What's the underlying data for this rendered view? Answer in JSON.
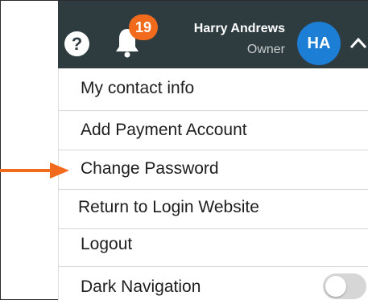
{
  "header": {
    "notification_count": "19",
    "user_name": "Harry Andrews",
    "user_role": "Owner",
    "avatar_initials": "HA",
    "help_icon": "question-circle-icon",
    "bell_icon": "bell-icon",
    "expand_icon": "chevron-up-icon"
  },
  "menu": {
    "items": [
      {
        "label": "My contact info"
      },
      {
        "label": "Add Payment Account"
      },
      {
        "label": "Change Password"
      },
      {
        "label": "Return to Login Website"
      },
      {
        "label": "Logout"
      }
    ],
    "dark_navigation": {
      "label": "Dark Navigation",
      "enabled": false
    }
  },
  "annotation": {
    "pointer_icon": "arrow-right-icon",
    "pointer_color": "#f26b1d"
  },
  "colors": {
    "topbar": "#2e3b3f",
    "badge": "#f26b1d",
    "avatar": "#1d7ed6"
  }
}
